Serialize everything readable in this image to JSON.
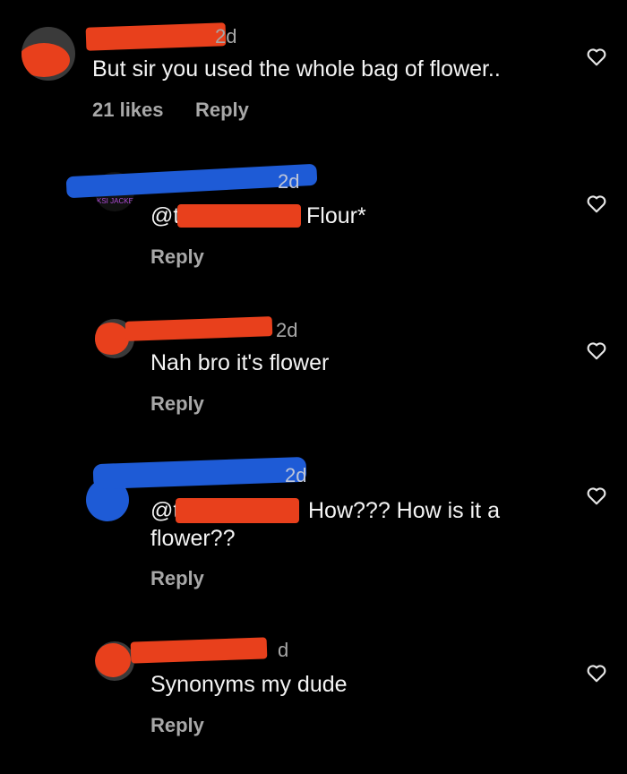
{
  "comments": [
    {
      "age": "2d",
      "text": "But sir you used the whole bag of flower..",
      "likes": "21 likes",
      "reply": "Reply",
      "icon": "heart-outline-icon"
    },
    {
      "age": "2d",
      "mention_prefix": "@t",
      "text": "Flour*",
      "reply": "Reply",
      "avatar_text": "KSI JACKETE",
      "icon": "heart-outline-icon"
    },
    {
      "age": "2d",
      "text": "Nah bro it's flower",
      "reply": "Reply",
      "icon": "heart-outline-icon"
    },
    {
      "age": "2d",
      "mention_prefix": "@t",
      "text": "How??? How is it a",
      "text_line2": "flower??",
      "reply": "Reply",
      "icon": "heart-outline-icon"
    },
    {
      "age": "d",
      "text": "Synonyms my dude",
      "reply": "Reply",
      "icon": "heart-outline-icon"
    }
  ],
  "colors": {
    "background": "#000000",
    "redact_red": "#e8401c",
    "redact_blue": "#1e5bd6"
  }
}
